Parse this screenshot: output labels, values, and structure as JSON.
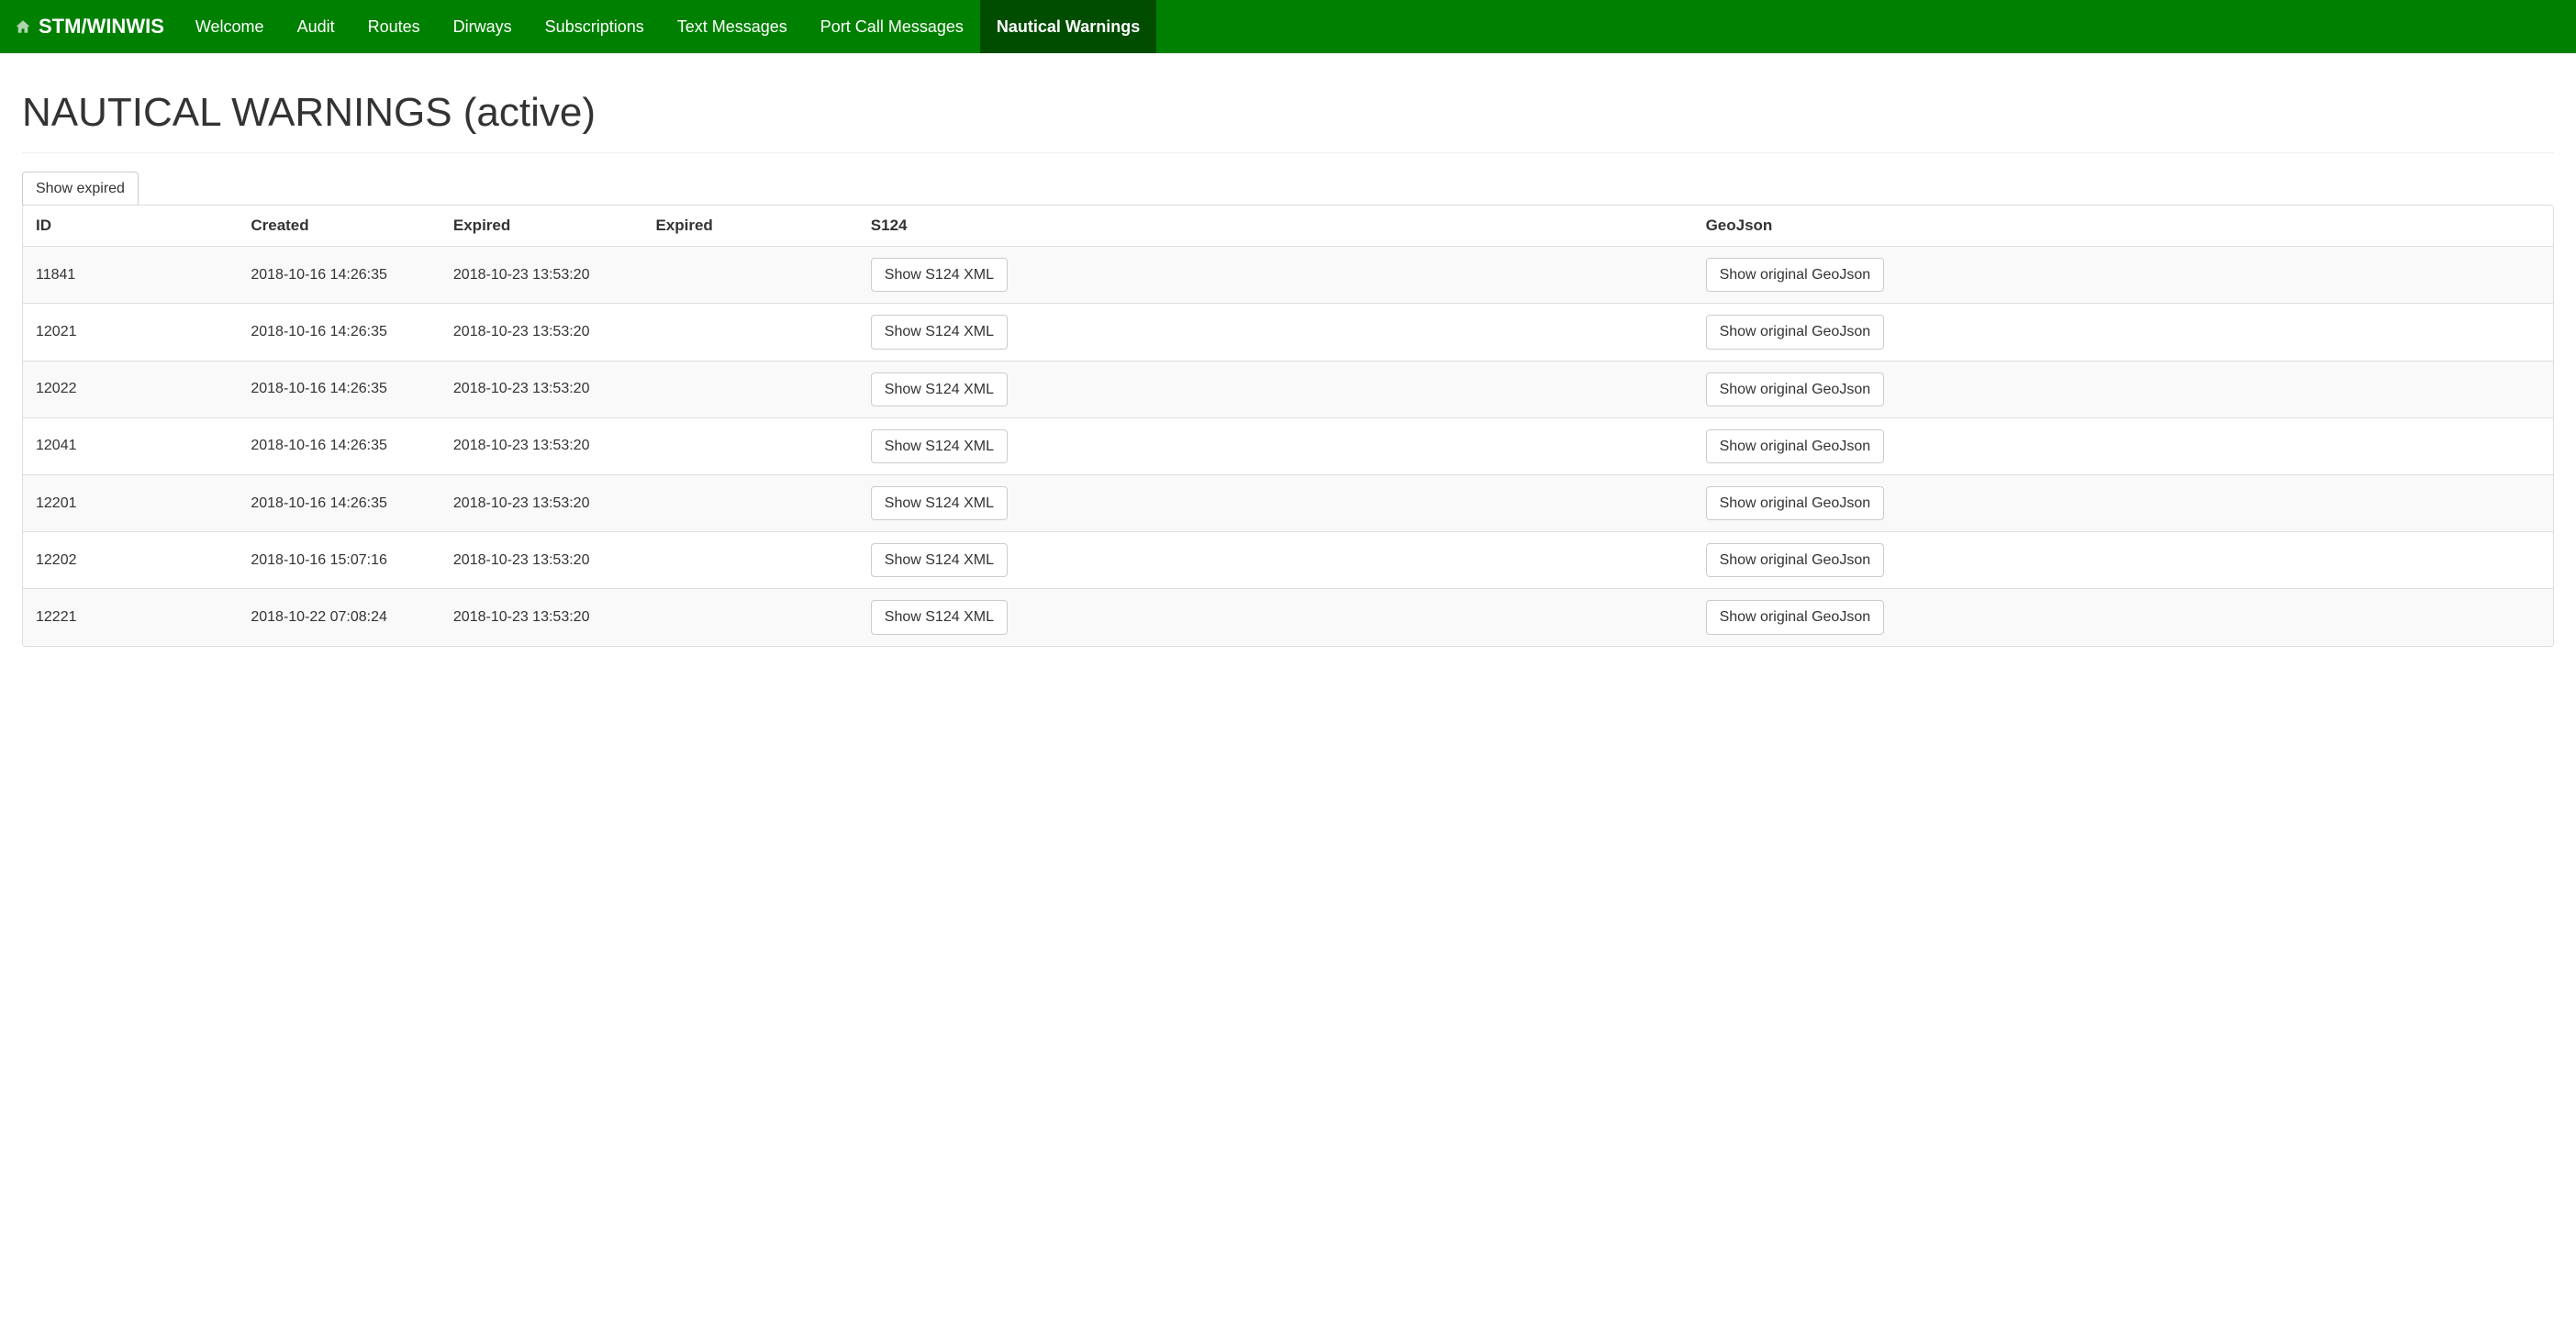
{
  "brand": "STM/WINWIS",
  "nav": [
    {
      "label": "Welcome",
      "active": false
    },
    {
      "label": "Audit",
      "active": false
    },
    {
      "label": "Routes",
      "active": false
    },
    {
      "label": "Dirways",
      "active": false
    },
    {
      "label": "Subscriptions",
      "active": false
    },
    {
      "label": "Text Messages",
      "active": false
    },
    {
      "label": "Port Call Messages",
      "active": false
    },
    {
      "label": "Nautical Warnings",
      "active": true
    }
  ],
  "page_title": "NAUTICAL WARNINGS (active)",
  "buttons": {
    "show_expired": "Show expired",
    "show_s124": "Show S124 XML",
    "show_geojson": "Show original GeoJson"
  },
  "columns": {
    "id": "ID",
    "created": "Created",
    "expired1": "Expired",
    "expired2": "Expired",
    "s124": "S124",
    "geojson": "GeoJson"
  },
  "rows": [
    {
      "id": "11841",
      "created": "2018-10-16 14:26:35",
      "expired": "2018-10-23 13:53:20"
    },
    {
      "id": "12021",
      "created": "2018-10-16 14:26:35",
      "expired": "2018-10-23 13:53:20"
    },
    {
      "id": "12022",
      "created": "2018-10-16 14:26:35",
      "expired": "2018-10-23 13:53:20"
    },
    {
      "id": "12041",
      "created": "2018-10-16 14:26:35",
      "expired": "2018-10-23 13:53:20"
    },
    {
      "id": "12201",
      "created": "2018-10-16 14:26:35",
      "expired": "2018-10-23 13:53:20"
    },
    {
      "id": "12202",
      "created": "2018-10-16 15:07:16",
      "expired": "2018-10-23 13:53:20"
    },
    {
      "id": "12221",
      "created": "2018-10-22 07:08:24",
      "expired": "2018-10-23 13:53:20"
    }
  ]
}
